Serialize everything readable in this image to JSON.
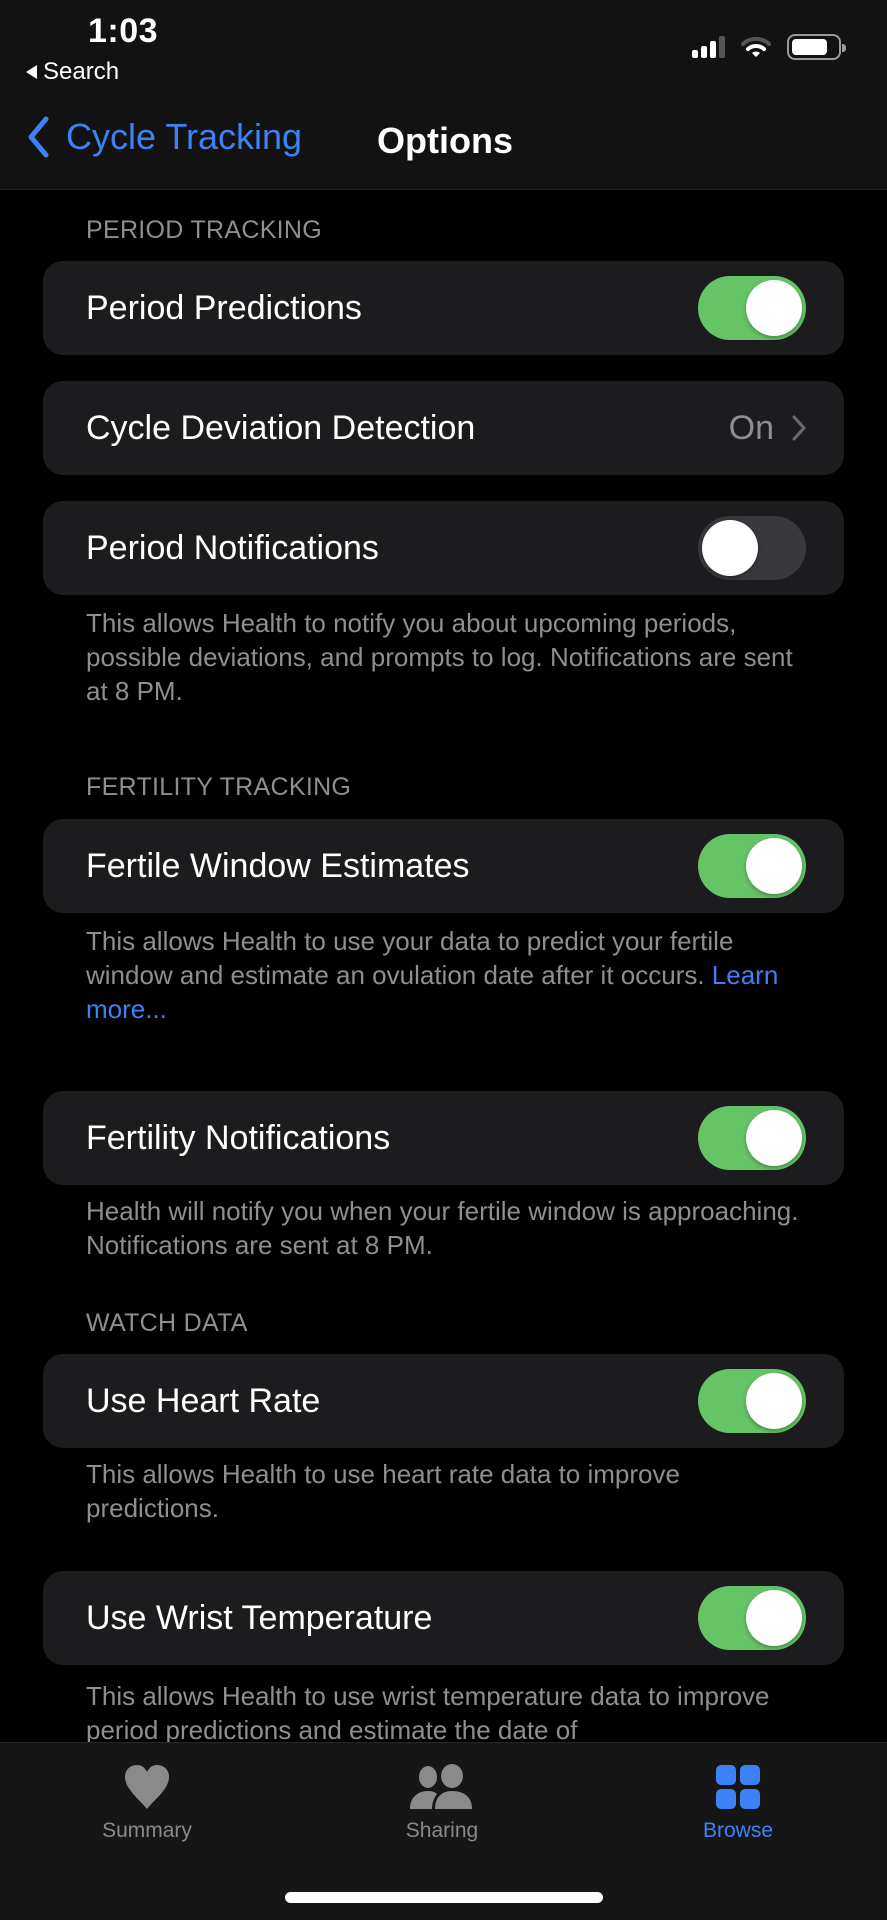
{
  "status_bar": {
    "time": "1:03",
    "back_app_label": "Search",
    "signal_bars_active": 3,
    "signal_bars_total": 4,
    "wifi_arcs_active": 2,
    "wifi_arcs_total": 3,
    "battery_level": 0.8
  },
  "nav": {
    "back_label": "Cycle Tracking",
    "title": "Options"
  },
  "sections": {
    "period": {
      "header": "PERIOD TRACKING",
      "period_predictions": {
        "label": "Period Predictions",
        "on": true
      },
      "cycle_deviation": {
        "label": "Cycle Deviation Detection",
        "value": "On"
      },
      "period_notifications": {
        "label": "Period Notifications",
        "on": false,
        "footer": "This allows Health to notify you about upcoming periods, possible deviations, and prompts to log. Notifications are sent at 8 PM."
      }
    },
    "fertility": {
      "header": "FERTILITY TRACKING",
      "fertile_window": {
        "label": "Fertile Window Estimates",
        "on": true,
        "footer": "This allows Health to use your data to predict your fertile window and estimate an ovulation date after it occurs. ",
        "link": "Learn more..."
      },
      "fertility_notifications": {
        "label": "Fertility Notifications",
        "on": true,
        "footer": "Health will notify you when your fertile window is approaching. Notifications are sent at 8 PM."
      }
    },
    "watch": {
      "header": "WATCH DATA",
      "heart_rate": {
        "label": "Use Heart Rate",
        "on": true,
        "footer": "This allows Health to use heart rate data to improve predictions."
      },
      "wrist_temp": {
        "label": "Use Wrist Temperature",
        "on": true,
        "footer": "This allows Health to use wrist temperature data to improve period predictions and estimate the date of"
      }
    }
  },
  "tabbar": {
    "tabs": [
      {
        "label": "Summary",
        "icon": "heart-icon",
        "active": false
      },
      {
        "label": "Sharing",
        "icon": "people-icon",
        "active": false
      },
      {
        "label": "Browse",
        "icon": "grid-icon",
        "active": true
      }
    ]
  },
  "colors": {
    "accent": "#3c82f6",
    "toggle_on": "#65c466",
    "toggle_off": "#39393d",
    "cell_bg": "#1c1c1e",
    "secondary_text": "#8e8e93"
  }
}
